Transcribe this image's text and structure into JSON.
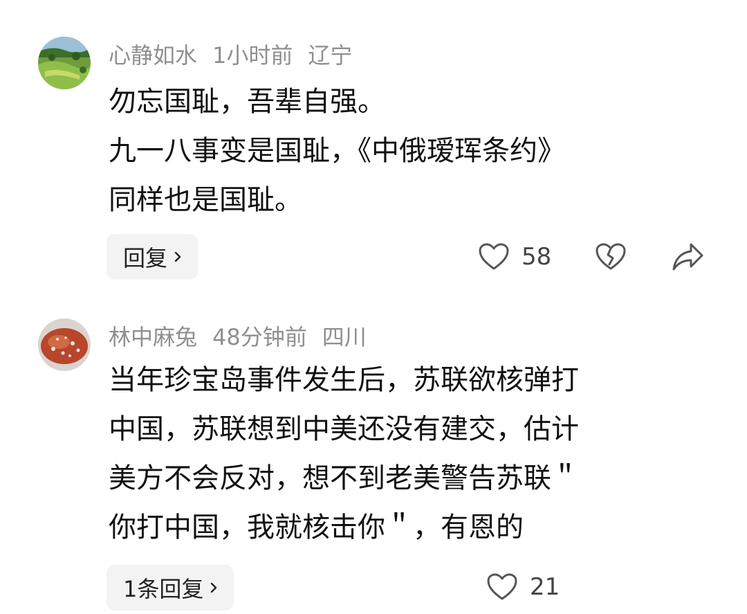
{
  "comments": [
    {
      "username": "心静如水",
      "time": "1小时前",
      "location": "辽宁",
      "lines": [
        "勿忘国耻，吾辈自强。",
        "九一八事变是国耻，《中俄瑷珲条约》",
        "同样也是国耻。"
      ],
      "reply_label": "回复",
      "likes": "58",
      "avatar": "green-landscape"
    },
    {
      "username": "林中麻兔",
      "time": "48分钟前",
      "location": "四川",
      "lines": [
        "当年珍宝岛事件发生后，苏联欲核弹打",
        "中国，苏联想到中美还没有建交，估计",
        "美方不会反对，想不到老美警告苏联＂",
        "你打中国，我就核击你＂，有恩的"
      ],
      "reply_label": "1条回复",
      "likes": "21",
      "avatar": "red-stone"
    }
  ],
  "icons": {
    "like": "heart-outline-icon",
    "dislike": "broken-heart-icon",
    "share": "share-arrow-icon",
    "chevron": "chevron-right-icon"
  },
  "colors": {
    "meta": "#8f8f8f",
    "text": "#111111",
    "button_bg": "#f3f3f3"
  }
}
